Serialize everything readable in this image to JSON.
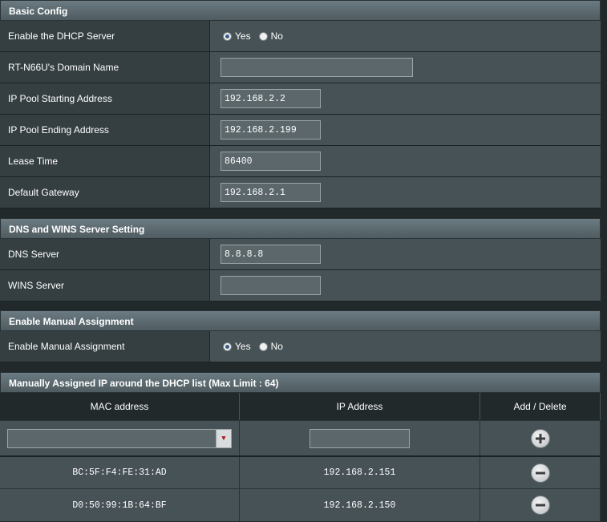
{
  "basic_config": {
    "header": "Basic Config",
    "dhcp_label": "Enable the DHCP Server",
    "dhcp_yes": "Yes",
    "dhcp_no": "No",
    "domain_label": "RT-N66U's Domain Name",
    "domain_value": "",
    "pool_start_label": "IP Pool Starting Address",
    "pool_start_value": "192.168.2.2",
    "pool_end_label": "IP Pool Ending Address",
    "pool_end_value": "192.168.2.199",
    "lease_label": "Lease Time",
    "lease_value": "86400",
    "gateway_label": "Default Gateway",
    "gateway_value": "192.168.2.1"
  },
  "dns_wins": {
    "header": "DNS and WINS Server Setting",
    "dns_label": "DNS Server",
    "dns_value": "8.8.8.8",
    "wins_label": "WINS Server",
    "wins_value": ""
  },
  "manual": {
    "header": "Enable Manual Assignment",
    "label": "Enable Manual Assignment",
    "yes": "Yes",
    "no": "No"
  },
  "dhcp_list": {
    "header": "Manually Assigned IP around the DHCP list (Max Limit : 64)",
    "col_mac": "MAC address",
    "col_ip": "IP Address",
    "col_action": "Add / Delete",
    "rows": [
      {
        "mac": "BC:5F:F4:FE:31:AD",
        "ip": "192.168.2.151"
      },
      {
        "mac": "D0:50:99:1B:64:BF",
        "ip": "192.168.2.150"
      }
    ]
  },
  "icons": {
    "add": "plus-circle-icon",
    "delete": "minus-circle-icon",
    "dropdown": "caret-down-icon"
  },
  "colors": {
    "background": "#21292b",
    "label_bg": "#353f42",
    "value_bg": "#475256",
    "dropdown_arrow": "#b2171a"
  }
}
